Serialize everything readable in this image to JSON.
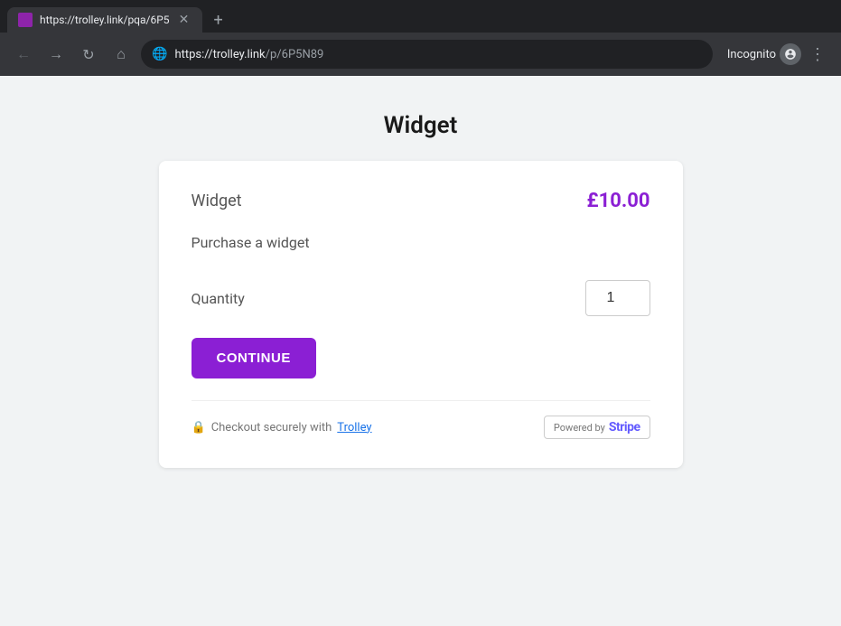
{
  "browser": {
    "tab": {
      "favicon_bg": "#8e24aa",
      "title": "https://trolley.link/pqa/6P5",
      "close_icon": "✕"
    },
    "new_tab_icon": "+",
    "nav": {
      "back_icon": "←",
      "forward_icon": "→",
      "reload_icon": "↻",
      "home_icon": "⌂"
    },
    "address": {
      "globe_icon": "🌐",
      "protocol": "https://",
      "domain": "trolley.link",
      "path": "/p/6P5N89"
    },
    "incognito_label": "Incognito",
    "menu_dots": "⋮"
  },
  "page": {
    "title": "Widget"
  },
  "card": {
    "product_name": "Widget",
    "product_price": "£10.00",
    "product_description": "Purchase a widget",
    "quantity_label": "Quantity",
    "quantity_value": "1",
    "continue_button_label": "CONTINUE",
    "footer": {
      "lock_icon": "🔒",
      "secure_text": "Checkout securely with",
      "trolley_link_label": "Trolley",
      "stripe_powered_label": "Powered by",
      "stripe_logo_label": "Stripe"
    }
  }
}
